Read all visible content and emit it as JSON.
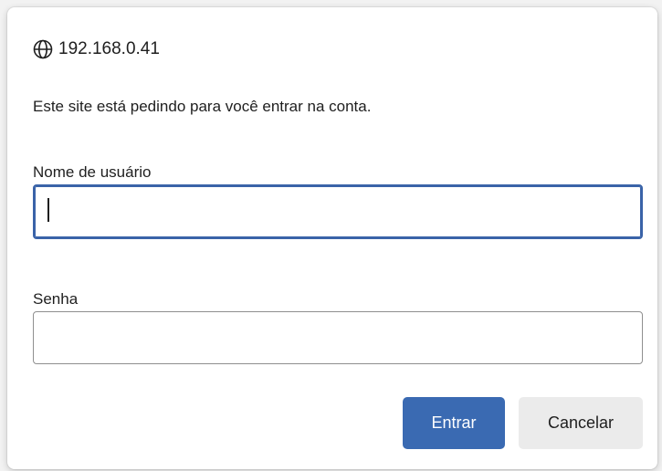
{
  "dialog": {
    "origin": "192.168.0.41",
    "origin_icon": "globe-icon",
    "message": "Este site está pedindo para você entrar na conta.",
    "username": {
      "label": "Nome de usuário",
      "value": ""
    },
    "password": {
      "label": "Senha",
      "value": ""
    },
    "buttons": {
      "submit": "Entrar",
      "cancel": "Cancelar"
    }
  },
  "colors": {
    "accent": "#3a6ab2",
    "focus_border": "#3a63a8",
    "secondary_button": "#ebebeb"
  }
}
